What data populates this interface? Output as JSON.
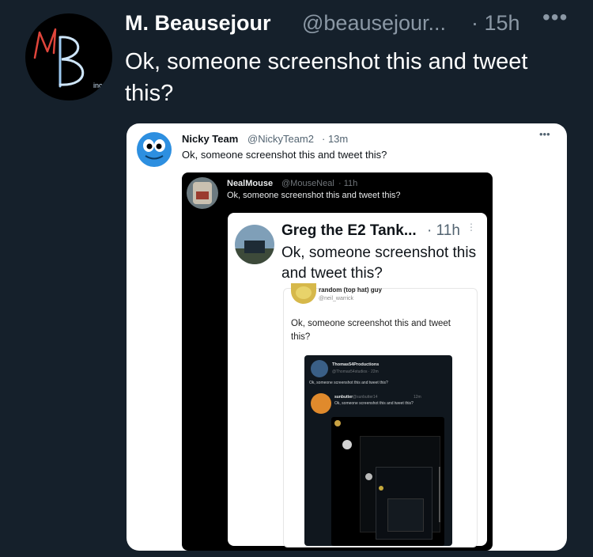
{
  "tweet": {
    "author_name": "M. Beausejour",
    "author_handle": "@beausejour...",
    "time": "· 15h",
    "more": "•••",
    "text": "Ok, someone screenshot this and tweet this?",
    "avatar_text": "MB",
    "avatar_sub": "inc"
  },
  "quote1": {
    "name": "Nicky Team",
    "handle": "@NickyTeam2",
    "time": "· 13m",
    "text": "Ok, someone screenshot this and tweet this?",
    "more": "•••"
  },
  "quote2": {
    "name": "NealMouse",
    "handle": "@MouseNeal",
    "time": "· 11h",
    "text": "Ok, someone screenshot this and tweet this?"
  },
  "quote3": {
    "name": "Greg the E2 Tank...",
    "time": "· 11h",
    "text": "Ok, someone screenshot this and tweet this?",
    "more": "⋮"
  },
  "quote4": {
    "name": "random (top hat) guy",
    "handle": "@neil_warrick",
    "text": "Ok, someone screenshot this and tweet this?"
  },
  "quote5": {
    "name": "Thomas54Productions",
    "handle": "@Thomas54studios · 22m",
    "text": "Ok, someone screenshot this and tweet this?"
  },
  "quote6": {
    "name": "sunbutter",
    "handle": "@sunbutter14",
    "time": "12m",
    "text": "Ok, someone screenshot this and tweet this?"
  },
  "colors": {
    "background": "#15202b",
    "card": "#ffffff",
    "secondary_text": "#8b98a5"
  }
}
